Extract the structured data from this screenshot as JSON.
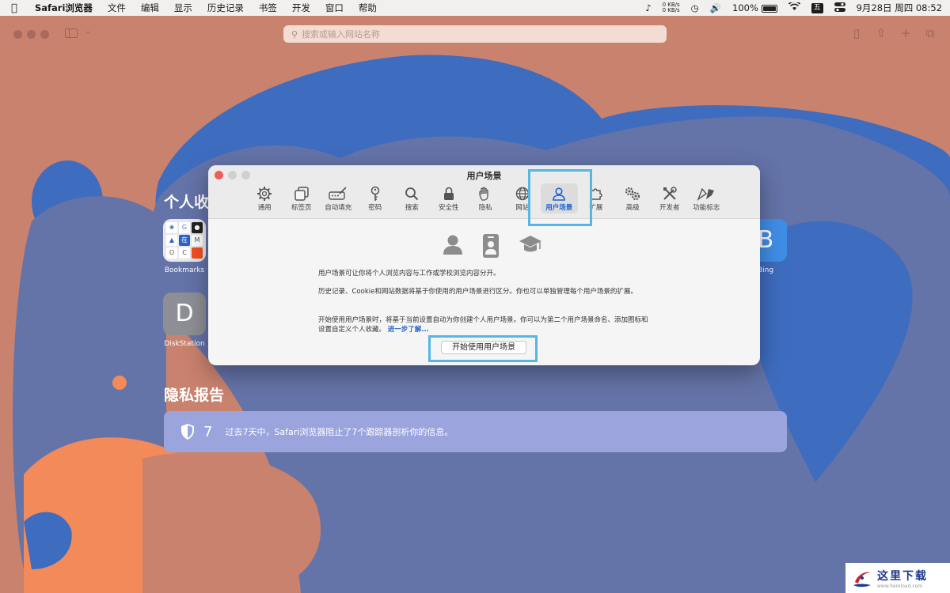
{
  "menubar": {
    "app_name": "Safari浏览器",
    "items": [
      "文件",
      "编辑",
      "显示",
      "历史记录",
      "书签",
      "开发",
      "窗口",
      "帮助"
    ],
    "net_up": "0 KB/s",
    "net_down": "0 KB/s",
    "battery": "100%",
    "ime": "五",
    "datetime": "9月28日 周四  08:52"
  },
  "toolbar": {
    "search_placeholder": "搜索或输入网站名称"
  },
  "start_page": {
    "favorites_title": "个人收",
    "favorites": [
      {
        "label": "Bookmarks"
      },
      {
        "label": "DiskStation",
        "letter": "D"
      },
      {
        "label": "Bing",
        "letter": "B"
      }
    ],
    "privacy_title": "隐私报告",
    "privacy_count": "7",
    "privacy_message": "过去7天中，Safari浏览器阻止了7个跟踪器剖析你的信息。"
  },
  "prefs": {
    "title": "用户场景",
    "tabs": [
      {
        "label": "通用",
        "icon": "gear-icon"
      },
      {
        "label": "标签页",
        "icon": "tabs-icon"
      },
      {
        "label": "自动填充",
        "icon": "autofill-icon"
      },
      {
        "label": "密码",
        "icon": "key-icon"
      },
      {
        "label": "搜索",
        "icon": "search-icon"
      },
      {
        "label": "安全性",
        "icon": "lock-icon"
      },
      {
        "label": "隐私",
        "icon": "hand-icon"
      },
      {
        "label": "网站",
        "icon": "globe-icon"
      },
      {
        "label": "用户场景",
        "icon": "person-icon",
        "active": true
      },
      {
        "label": "扩展",
        "icon": "puzzle-icon"
      },
      {
        "label": "高级",
        "icon": "gears-icon"
      },
      {
        "label": "开发者",
        "icon": "tools-icon"
      },
      {
        "label": "功能标志",
        "icon": "flags-icon"
      }
    ],
    "para1": "用户场景可让你将个人浏览内容与工作或学校浏览内容分开。",
    "para2": "历史记录、Cookie和网站数据将基于你使用的用户场景进行区分。你也可以单独管理每个用户场景的扩展。",
    "para3": "开始使用用户场景时，将基于当前设置自动为你创建个人用户场景。你可以为第二个用户场景命名、添加图标和设置自定义个人收藏。",
    "learn_more": "进一步了解...",
    "start_button": "开始使用用户场景"
  },
  "watermark": {
    "text": "这里下载",
    "sub": "www.hereload.com"
  }
}
